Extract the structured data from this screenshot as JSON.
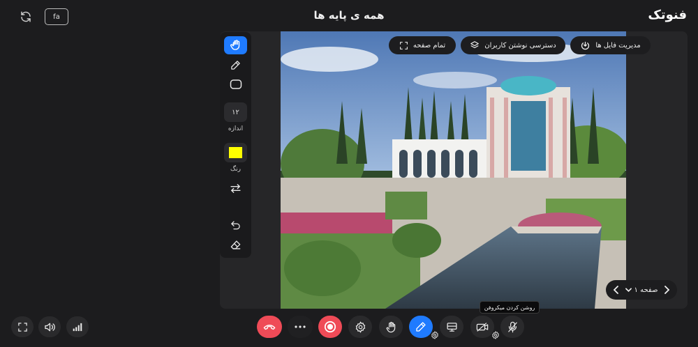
{
  "header": {
    "brand": "فنوتک",
    "title": "همه ی پایه ها",
    "lang_label": "fa"
  },
  "toolbar": {
    "size_value": "۱۲",
    "size_caption": "اندازه",
    "color_caption": "رنگ",
    "color_value": "#ffff00"
  },
  "overlay": {
    "fullscreen_label": "تمام صفحه",
    "access_label": "دسترسی نوشتن کاربران",
    "files_label": "مدیریت فایل ها"
  },
  "pager": {
    "label": "صفحه ۱"
  },
  "tooltip": {
    "text": "روشن کردن میکروفن"
  },
  "colors": {
    "accent": "#1f7bff",
    "danger": "#ef4b57",
    "surface": "#1c1c1e"
  },
  "icons": [
    "sync-icon",
    "pointer-hand-icon",
    "pencil-icon",
    "rectangle-icon",
    "swap-icon",
    "undo-icon",
    "eraser-icon",
    "fullscreen-icon",
    "layers-icon",
    "upload-icon",
    "chevron-left-icon",
    "chevron-right-icon",
    "chevron-down-icon",
    "expand-icon",
    "speaker-icon",
    "signal-icon",
    "hangup-icon",
    "more-icon",
    "record-icon",
    "settings-icon",
    "raise-hand-icon",
    "share-screen-icon",
    "camera-off-icon",
    "mic-off-icon"
  ]
}
